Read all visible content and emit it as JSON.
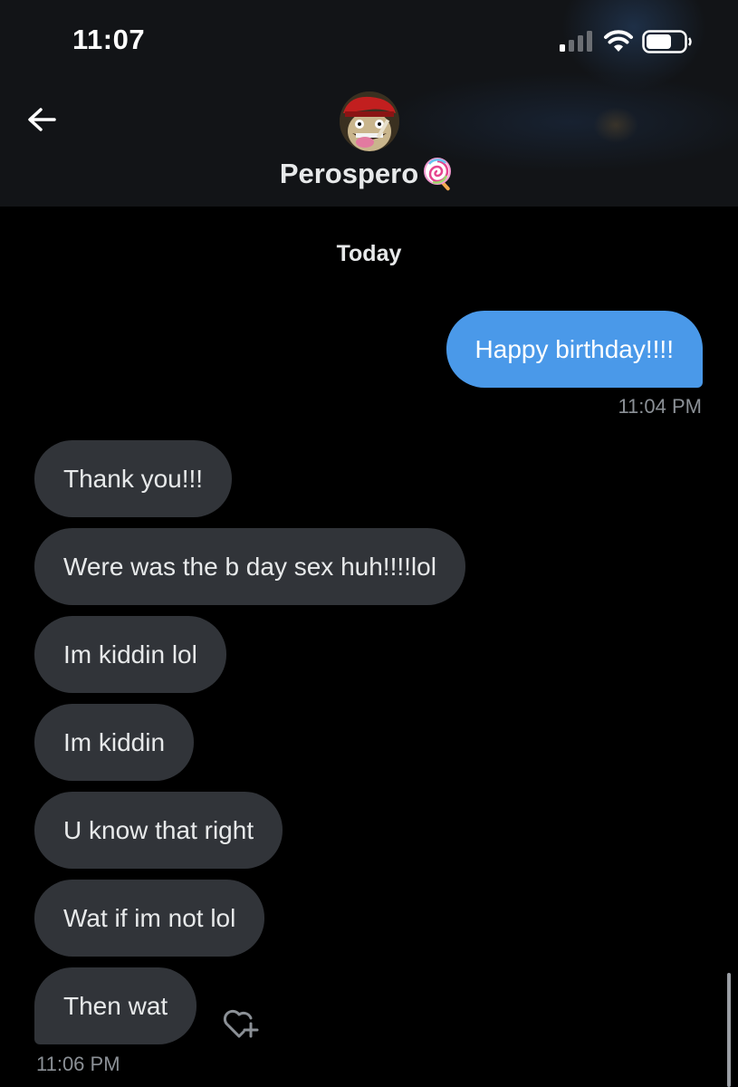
{
  "status_bar": {
    "time": "11:07"
  },
  "conversation": {
    "contact_name": "Perospero",
    "name_emoji": "lollipop",
    "date_separator": "Today"
  },
  "messages": [
    {
      "direction": "sent",
      "text": "Happy birthday!!!!",
      "timestamp": "11:04 PM"
    },
    {
      "direction": "received",
      "text": "Thank you!!!"
    },
    {
      "direction": "received",
      "text": "Were was the b day sex huh!!!!lol"
    },
    {
      "direction": "received",
      "text": "Im kiddin lol"
    },
    {
      "direction": "received",
      "text": "Im kiddin"
    },
    {
      "direction": "received",
      "text": "U know that right"
    },
    {
      "direction": "received",
      "text": "Wat if im not lol"
    },
    {
      "direction": "received",
      "text": "Then wat",
      "timestamp": "11:06 PM"
    }
  ],
  "icons": {
    "back": "arrow-left-icon",
    "info": "info-icon",
    "react": "heart-plus-icon"
  },
  "colors": {
    "background": "#000000",
    "header": "#121417",
    "sent_bubble": "#4a99e9",
    "received_bubble": "#313439",
    "timestamp": "#8b9096"
  }
}
